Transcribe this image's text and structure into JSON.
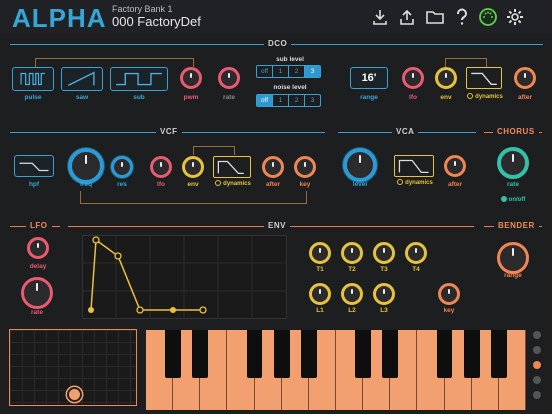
{
  "header": {
    "logo": "ALPHA",
    "bank_name": "Factory Bank 1",
    "preset_name": "000  FactoryDef",
    "icons": [
      "download-icon",
      "upload-icon",
      "folder-icon",
      "help-icon",
      "midi-icon",
      "settings-icon"
    ]
  },
  "colors": {
    "blue": "#3aa0d4",
    "orange": "#ef8654",
    "pink": "#ea5a70",
    "yellow": "#e8c23c",
    "teal": "#33c2a8",
    "background": "#1d1e20"
  },
  "dco": {
    "title": "DCO",
    "pulse": "pulse",
    "saw": "saw",
    "sub": "sub",
    "pwm": "pwm",
    "rate": "rate",
    "sub_level": {
      "title": "sub level",
      "options": [
        "off",
        "1",
        "2",
        "3"
      ],
      "selected": "3"
    },
    "noise_level": {
      "title": "noise level",
      "options": [
        "off",
        "1",
        "2",
        "3"
      ],
      "selected": "off"
    },
    "range_value": "16'",
    "range": "range",
    "lfo": "lfo",
    "env": "env",
    "dynamics": "dynamics",
    "after": "after"
  },
  "vcf": {
    "title": "VCF",
    "hpf": "hpf",
    "freq": "freq",
    "res": "res",
    "lfo": "lfo",
    "env": "env",
    "dynamics": "dynamics",
    "after": "after",
    "key": "key"
  },
  "vca": {
    "title": "VCA",
    "level": "level",
    "dynamics": "dynamics",
    "after": "after"
  },
  "chorus": {
    "title": "CHORUS",
    "rate": "rate",
    "onoff": "on/off"
  },
  "lfo": {
    "title": "LFO",
    "delay": "delay",
    "rate": "rate"
  },
  "env": {
    "title": "ENV",
    "knobs": [
      "T1",
      "T2",
      "T3",
      "T4",
      "L1",
      "L2",
      "L3"
    ],
    "key": "key"
  },
  "bender": {
    "title": "BENDER",
    "range": "range"
  }
}
